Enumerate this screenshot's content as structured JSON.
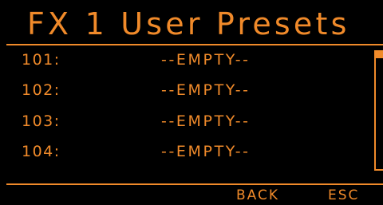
{
  "header": {
    "title": "FX 1 User Presets"
  },
  "presets": [
    {
      "number": "101:",
      "name": "--EMPTY--"
    },
    {
      "number": "102:",
      "name": "--EMPTY--"
    },
    {
      "number": "103:",
      "name": "--EMPTY--"
    },
    {
      "number": "104:",
      "name": "--EMPTY--"
    }
  ],
  "softkeys": {
    "back": "BACK",
    "esc": "ESC"
  },
  "colors": {
    "background": "#000000",
    "accent": "#f08a2a"
  }
}
